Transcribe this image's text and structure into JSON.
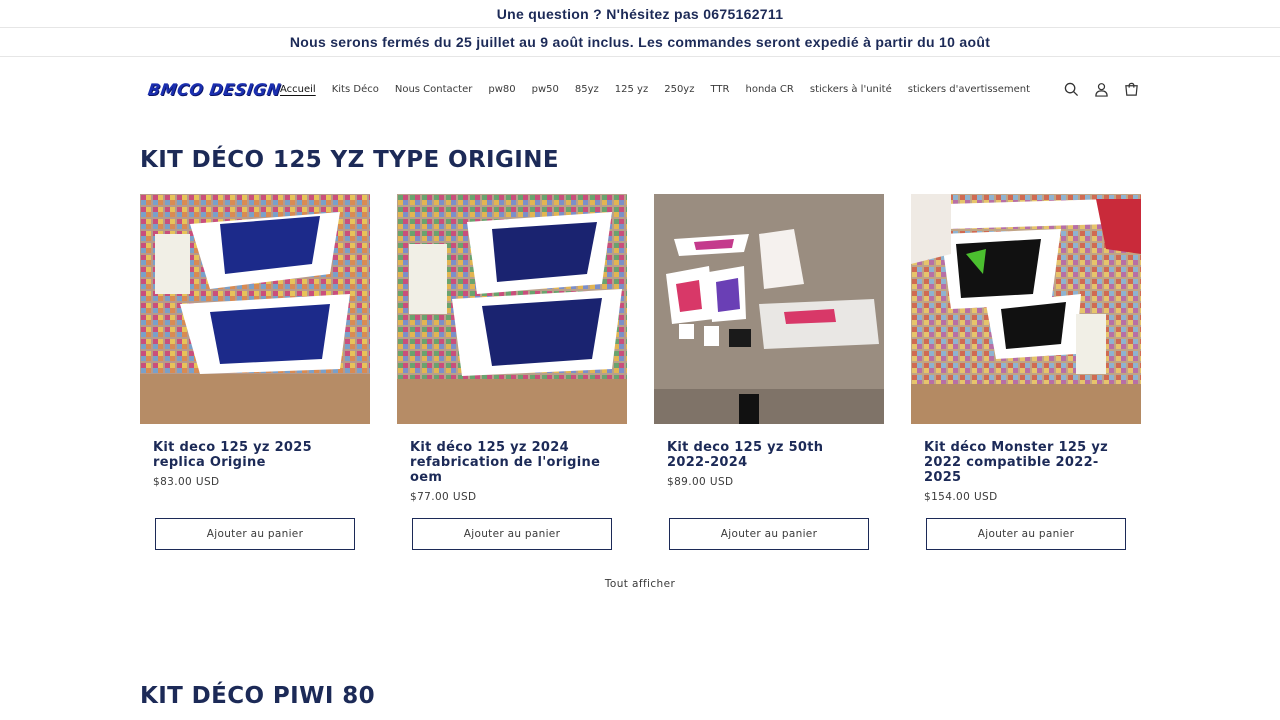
{
  "announcements": {
    "line1": "Une question ? N'hésitez pas 0675162711",
    "line2": "Nous serons fermés du 25 juillet au 9 août inclus. Les commandes seront expedié à partir du 10 août"
  },
  "header": {
    "logo": "BMCO DESIGN",
    "nav": [
      "Accueil",
      "Kits Déco",
      "Nous Contacter",
      "pw80",
      "pw50",
      "85yz",
      "125 yz",
      "250yz",
      "TTR",
      "honda CR",
      "stickers à l'unité",
      "stickers d'avertissement"
    ],
    "active_nav": "Accueil",
    "icons": [
      "search-icon",
      "account-icon",
      "cart-icon"
    ]
  },
  "section1": {
    "title": "KIT DÉCO 125 YZ TYPE ORIGINE",
    "products": [
      {
        "title": "Kit deco 125 yz 2025 replica Origine",
        "price": "$83.00 USD",
        "button": "Ajouter au panier"
      },
      {
        "title": "Kit déco 125 yz 2024 refabrication de l'origine oem",
        "price": "$77.00 USD",
        "button": "Ajouter au panier"
      },
      {
        "title": "Kit deco 125 yz 50th 2022-2024",
        "price": "$89.00 USD",
        "button": "Ajouter au panier"
      },
      {
        "title": "Kit déco Monster 125 yz 2022 compatible 2022-2025",
        "price": "$154.00 USD",
        "button": "Ajouter au panier"
      }
    ],
    "view_all": "Tout afficher"
  },
  "section2": {
    "title": "KIT DÉCO PIWI 80"
  },
  "colors": {
    "brand_navy": "#1c2a57",
    "logo_blue": "#1b2fb0"
  }
}
